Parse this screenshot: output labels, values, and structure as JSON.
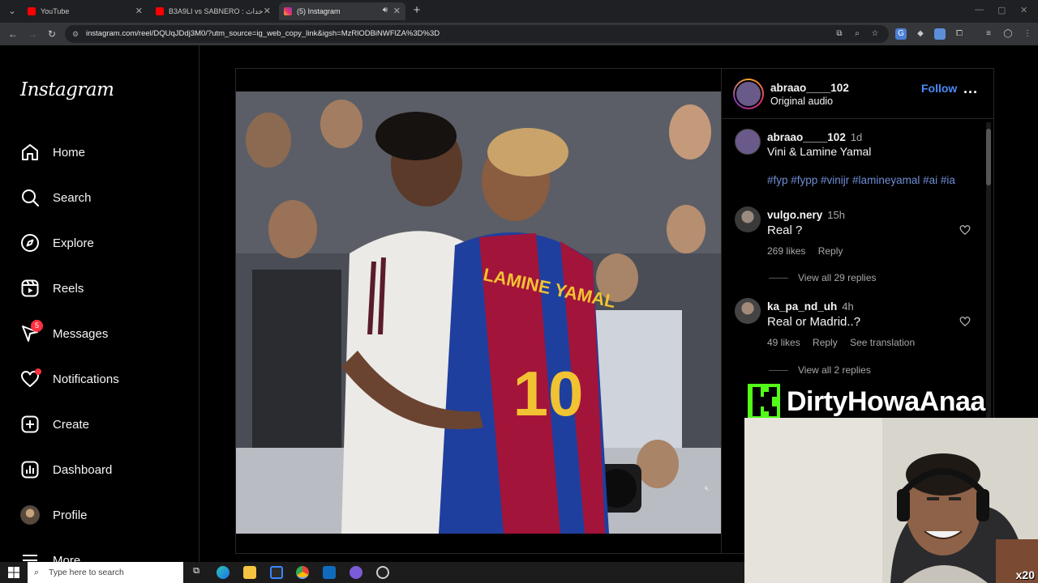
{
  "browser": {
    "tabs": [
      {
        "title": "YouTube",
        "favicon_color": "#ff0000"
      },
      {
        "title": "B3A9LI vs SABNERO : ج للأحداث",
        "favicon_color": "#ff0000"
      },
      {
        "title": "(5) Instagram",
        "favicon_color": "#e1306c"
      }
    ],
    "url": "instagram.com/reel/DQUqJDdj3M0/?utm_source=ig_web_copy_link&igsh=MzRlODBiNWFlZA%3D%3D"
  },
  "sidebar": {
    "logo": "Instagram",
    "items": [
      {
        "label": "Home",
        "icon": "home-icon"
      },
      {
        "label": "Search",
        "icon": "search-icon"
      },
      {
        "label": "Explore",
        "icon": "compass-icon"
      },
      {
        "label": "Reels",
        "icon": "reels-icon"
      },
      {
        "label": "Messages",
        "icon": "messenger-icon",
        "badge": "5"
      },
      {
        "label": "Notifications",
        "icon": "heart-icon"
      },
      {
        "label": "Create",
        "icon": "plus-square-icon"
      },
      {
        "label": "Dashboard",
        "icon": "chart-icon"
      },
      {
        "label": "Profile",
        "icon": "avatar"
      },
      {
        "label": "More",
        "icon": "menu-icon"
      }
    ]
  },
  "post": {
    "author": "abraao____102",
    "audio": "Original audio",
    "follow_label": "Follow",
    "more_label": "...",
    "caption_author": "abraao____102",
    "caption_time": "1d",
    "caption_text": "Vini & Lamine Yamal",
    "hashtags": "#fyp #fypp #vinijr #lamineyamal #ai #ia",
    "jersey_text": "LAMINE YAMAL",
    "jersey_number": "10"
  },
  "comments": [
    {
      "user": "vulgo.nery",
      "time": "15h",
      "text": "Real ?",
      "likes": "269 likes",
      "reply": "Reply",
      "view_replies": "View all 29 replies"
    },
    {
      "user": "ka_pa_nd_uh",
      "time": "4h",
      "text": "Real or Madrid..?",
      "likes": "49 likes",
      "reply": "Reply",
      "translate": "See translation",
      "view_replies": "View all 2 replies"
    }
  ],
  "overlay": {
    "channel": "DirtyHowaAnaa",
    "logo_letter": "K",
    "multiplier": "x20",
    "accent": "#53fc18"
  },
  "taskbar": {
    "search_placeholder": "Type here to search"
  }
}
